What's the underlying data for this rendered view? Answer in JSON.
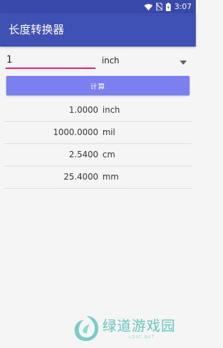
{
  "status_bar": {
    "time": "3:07"
  },
  "app_bar": {
    "title": "长度转换器"
  },
  "converter": {
    "input_value": "1",
    "selected_unit": "inch",
    "calculate_label": "计算"
  },
  "results": [
    {
      "value": "1.0000",
      "unit": "inch"
    },
    {
      "value": "1000.0000",
      "unit": "mil"
    },
    {
      "value": "2.5400",
      "unit": "cm"
    },
    {
      "value": "25.4000",
      "unit": "mm"
    }
  ],
  "watermark": {
    "text": "绿道游戏园",
    "sub": "LDYC.NET"
  },
  "colors": {
    "status_bar": "#3949ab",
    "app_bar": "#3f51b5",
    "input_underline": "#e91e63",
    "button": "#7b7ff0",
    "watermark": "#63c6be"
  },
  "icons": [
    "wifi-icon",
    "no-sim-icon",
    "battery-icon",
    "dropdown-arrow-icon"
  ]
}
